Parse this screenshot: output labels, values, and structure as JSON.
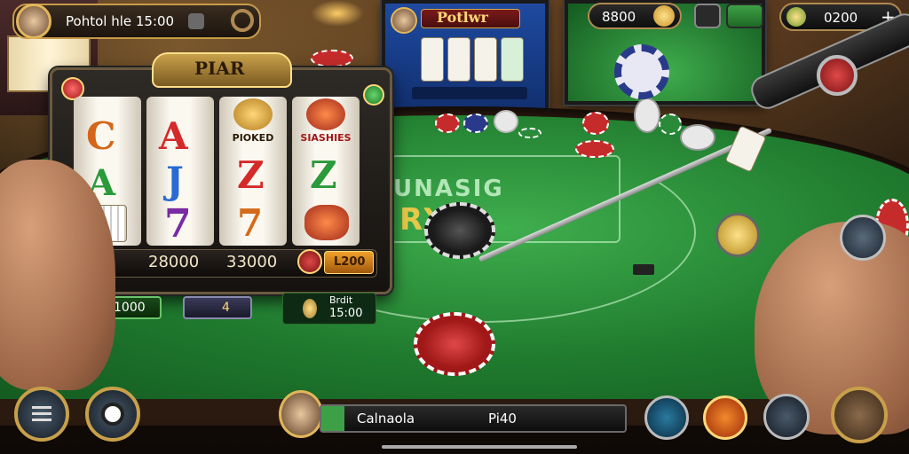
{
  "top_left_panel": {
    "text": "Pohtol hle 15:00"
  },
  "top_screen": {
    "title": "Potlwr"
  },
  "top_right": {
    "balance_1": "8800",
    "balance_2": "0200"
  },
  "slot": {
    "title": "PIAR",
    "reel_labels": [
      "PIOKED",
      "SIASHIES"
    ],
    "symbols": {
      "reel1": [
        "C",
        "A"
      ],
      "reel2": [
        "A",
        "J",
        "7"
      ],
      "reel3": [
        "Z",
        "7"
      ],
      "reel4": [
        "Z"
      ]
    },
    "amounts": [
      "28000",
      "33000"
    ],
    "bet_button": "L200"
  },
  "table": {
    "felt_text": "UNASIG",
    "felt_subtext": "RXS"
  },
  "lower_badges": {
    "credit": "1000",
    "option": "4",
    "bet_label": "Brdit",
    "bet_time": "15:00"
  },
  "bottom_bar": {
    "player_name": "Calnaola",
    "player_value": "Pi40"
  },
  "colors": {
    "felt": "#2a8f3a",
    "gold": "#d4a94a",
    "chip_red": "#c62b2b",
    "chip_blue": "#2a3a8a"
  }
}
